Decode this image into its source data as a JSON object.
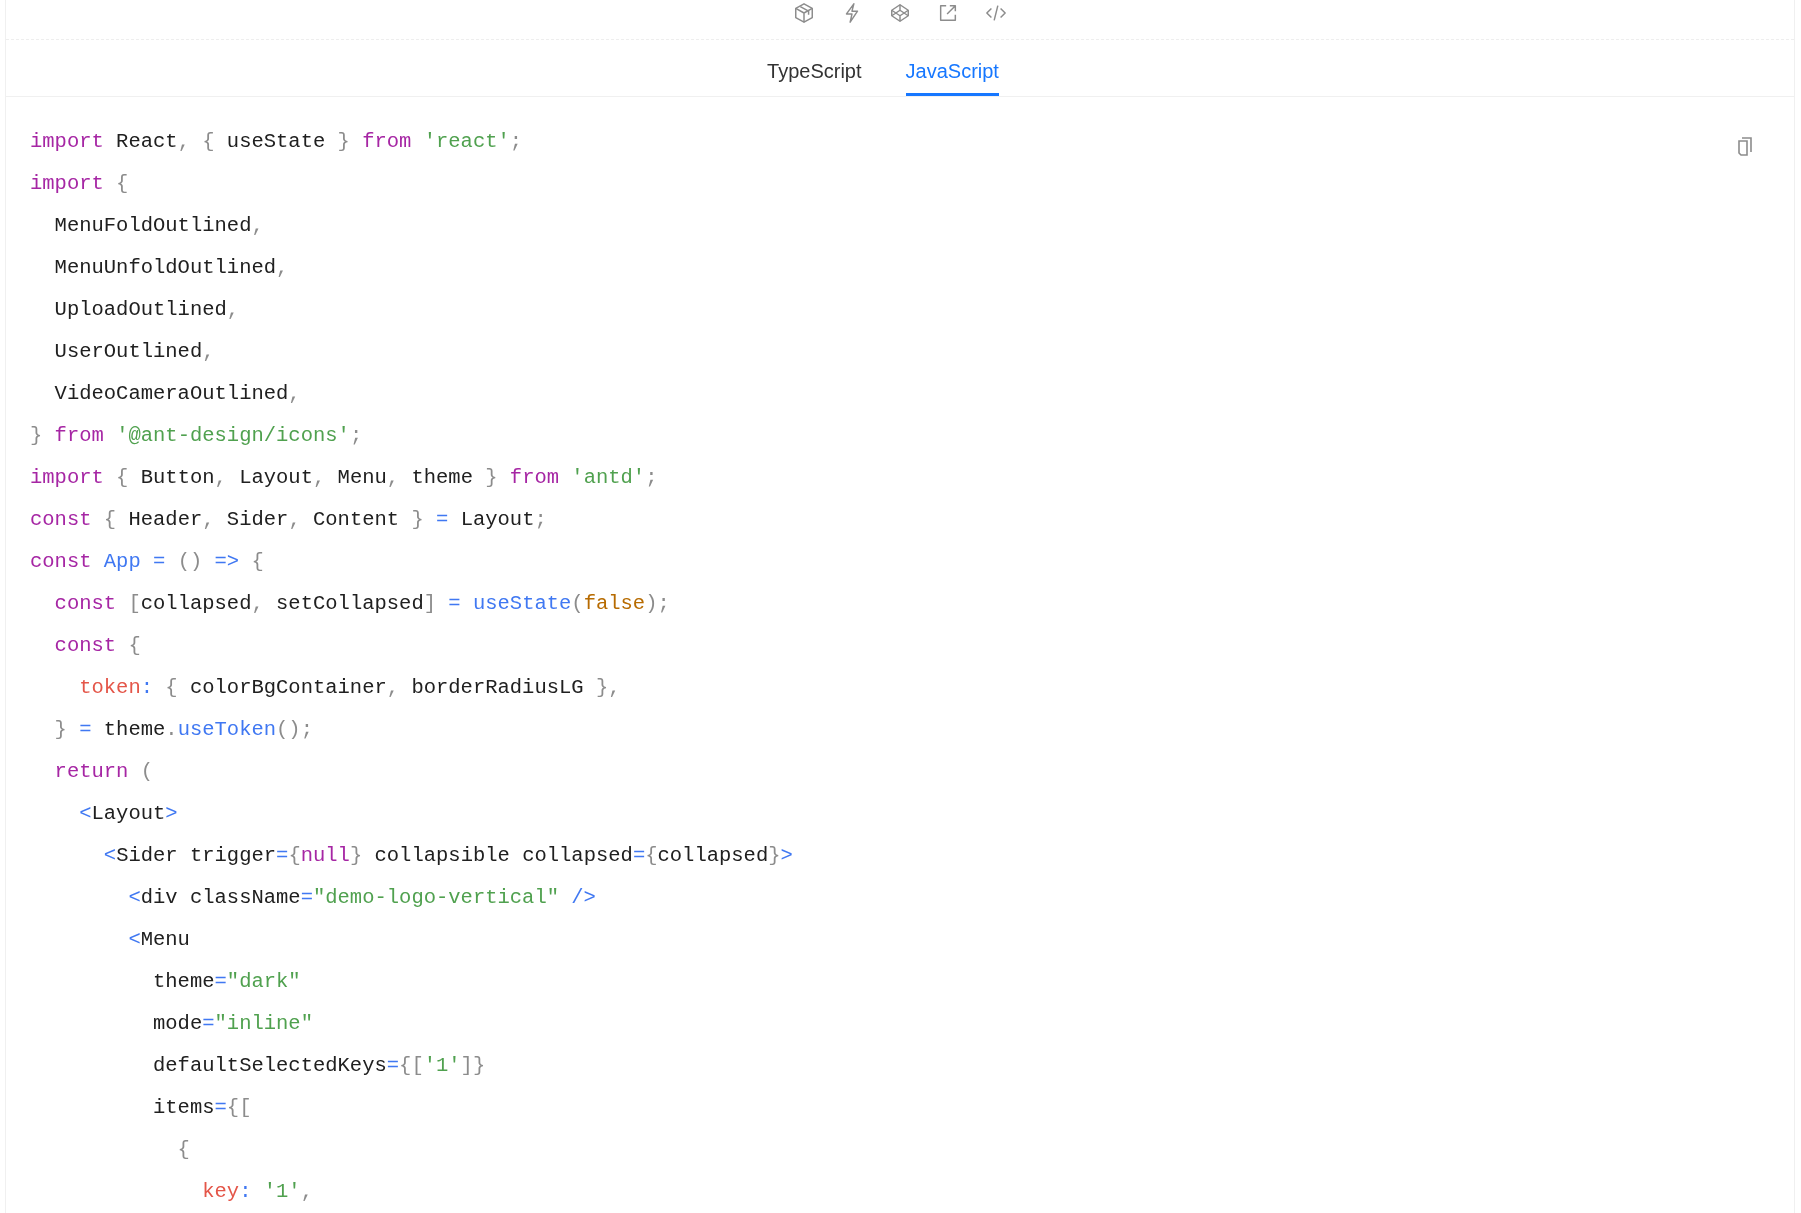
{
  "tabs": [
    {
      "label": "TypeScript",
      "selected": false
    },
    {
      "label": "JavaScript",
      "selected": true
    }
  ],
  "code": {
    "lines": [
      [
        {
          "kind": "keyword",
          "text": "import"
        },
        {
          "kind": "plain",
          "text": " React"
        },
        {
          "kind": "punct",
          "text": ", {"
        },
        {
          "kind": "plain",
          "text": " useState"
        },
        {
          "kind": "punct",
          "text": " }"
        },
        {
          "kind": "keyword",
          "text": " from"
        },
        {
          "kind": "string",
          "text": " 'react'"
        },
        {
          "kind": "punct",
          "text": ";"
        }
      ],
      [
        {
          "kind": "keyword",
          "text": "import"
        },
        {
          "kind": "punct",
          "text": " {"
        }
      ],
      [
        {
          "kind": "plain",
          "text": "  MenuFoldOutlined"
        },
        {
          "kind": "punct",
          "text": ","
        }
      ],
      [
        {
          "kind": "plain",
          "text": "  MenuUnfoldOutlined"
        },
        {
          "kind": "punct",
          "text": ","
        }
      ],
      [
        {
          "kind": "plain",
          "text": "  UploadOutlined"
        },
        {
          "kind": "punct",
          "text": ","
        }
      ],
      [
        {
          "kind": "plain",
          "text": "  UserOutlined"
        },
        {
          "kind": "punct",
          "text": ","
        }
      ],
      [
        {
          "kind": "plain",
          "text": "  VideoCameraOutlined"
        },
        {
          "kind": "punct",
          "text": ","
        }
      ],
      [
        {
          "kind": "punct",
          "text": "}"
        },
        {
          "kind": "keyword",
          "text": " from"
        },
        {
          "kind": "string",
          "text": " '@ant-design/icons'"
        },
        {
          "kind": "punct",
          "text": ";"
        }
      ],
      [
        {
          "kind": "keyword",
          "text": "import"
        },
        {
          "kind": "punct",
          "text": " {"
        },
        {
          "kind": "plain",
          "text": " Button"
        },
        {
          "kind": "punct",
          "text": ","
        },
        {
          "kind": "plain",
          "text": " Layout"
        },
        {
          "kind": "punct",
          "text": ","
        },
        {
          "kind": "plain",
          "text": " Menu"
        },
        {
          "kind": "punct",
          "text": ","
        },
        {
          "kind": "plain",
          "text": " theme"
        },
        {
          "kind": "punct",
          "text": " }"
        },
        {
          "kind": "keyword",
          "text": " from"
        },
        {
          "kind": "string",
          "text": " 'antd'"
        },
        {
          "kind": "punct",
          "text": ";"
        }
      ],
      [
        {
          "kind": "keyword",
          "text": "const"
        },
        {
          "kind": "punct",
          "text": " {"
        },
        {
          "kind": "plain",
          "text": " Header"
        },
        {
          "kind": "punct",
          "text": ","
        },
        {
          "kind": "plain",
          "text": " Sider"
        },
        {
          "kind": "punct",
          "text": ","
        },
        {
          "kind": "plain",
          "text": " Content"
        },
        {
          "kind": "punct",
          "text": " }"
        },
        {
          "kind": "operator",
          "text": " ="
        },
        {
          "kind": "plain",
          "text": " Layout"
        },
        {
          "kind": "punct",
          "text": ";"
        }
      ],
      [
        {
          "kind": "keyword",
          "text": "const"
        },
        {
          "kind": "function",
          "text": " App"
        },
        {
          "kind": "operator",
          "text": " ="
        },
        {
          "kind": "punct",
          "text": " ()"
        },
        {
          "kind": "operator",
          "text": " =>"
        },
        {
          "kind": "punct",
          "text": " {"
        }
      ],
      [
        {
          "kind": "keyword",
          "text": "  const"
        },
        {
          "kind": "punct",
          "text": " ["
        },
        {
          "kind": "plain",
          "text": "collapsed"
        },
        {
          "kind": "punct",
          "text": ","
        },
        {
          "kind": "plain",
          "text": " setCollapsed"
        },
        {
          "kind": "punct",
          "text": "]"
        },
        {
          "kind": "operator",
          "text": " ="
        },
        {
          "kind": "function",
          "text": " useState"
        },
        {
          "kind": "punct",
          "text": "("
        },
        {
          "kind": "boolean",
          "text": "false"
        },
        {
          "kind": "punct",
          "text": ");"
        }
      ],
      [
        {
          "kind": "keyword",
          "text": "  const"
        },
        {
          "kind": "punct",
          "text": " {"
        }
      ],
      [
        {
          "kind": "property",
          "text": "    token"
        },
        {
          "kind": "operator",
          "text": ":"
        },
        {
          "kind": "punct",
          "text": " {"
        },
        {
          "kind": "plain",
          "text": " colorBgContainer"
        },
        {
          "kind": "punct",
          "text": ","
        },
        {
          "kind": "plain",
          "text": " borderRadiusLG"
        },
        {
          "kind": "punct",
          "text": " },"
        }
      ],
      [
        {
          "kind": "punct",
          "text": "  }"
        },
        {
          "kind": "operator",
          "text": " ="
        },
        {
          "kind": "plain",
          "text": " theme"
        },
        {
          "kind": "punct",
          "text": "."
        },
        {
          "kind": "function",
          "text": "useToken"
        },
        {
          "kind": "punct",
          "text": "();"
        }
      ],
      [
        {
          "kind": "keyword",
          "text": "  return"
        },
        {
          "kind": "punct",
          "text": " ("
        }
      ],
      [
        {
          "kind": "operator",
          "text": "    <"
        },
        {
          "kind": "plain",
          "text": "Layout"
        },
        {
          "kind": "operator",
          "text": ">"
        }
      ],
      [
        {
          "kind": "operator",
          "text": "      <"
        },
        {
          "kind": "plain",
          "text": "Sider trigger"
        },
        {
          "kind": "operator",
          "text": "="
        },
        {
          "kind": "punct",
          "text": "{"
        },
        {
          "kind": "keyword",
          "text": "null"
        },
        {
          "kind": "punct",
          "text": "}"
        },
        {
          "kind": "plain",
          "text": " collapsible collapsed"
        },
        {
          "kind": "operator",
          "text": "="
        },
        {
          "kind": "punct",
          "text": "{"
        },
        {
          "kind": "plain",
          "text": "collapsed"
        },
        {
          "kind": "punct",
          "text": "}"
        },
        {
          "kind": "operator",
          "text": ">"
        }
      ],
      [
        {
          "kind": "operator",
          "text": "        <"
        },
        {
          "kind": "plain",
          "text": "div className"
        },
        {
          "kind": "operator",
          "text": "="
        },
        {
          "kind": "string",
          "text": "\"demo-logo-vertical\""
        },
        {
          "kind": "operator",
          "text": " />"
        }
      ],
      [
        {
          "kind": "operator",
          "text": "        <"
        },
        {
          "kind": "plain",
          "text": "Menu"
        }
      ],
      [
        {
          "kind": "plain",
          "text": "          theme"
        },
        {
          "kind": "operator",
          "text": "="
        },
        {
          "kind": "string",
          "text": "\"dark\""
        }
      ],
      [
        {
          "kind": "plain",
          "text": "          mode"
        },
        {
          "kind": "operator",
          "text": "="
        },
        {
          "kind": "string",
          "text": "\"inline\""
        }
      ],
      [
        {
          "kind": "plain",
          "text": "          defaultSelectedKeys"
        },
        {
          "kind": "operator",
          "text": "="
        },
        {
          "kind": "punct",
          "text": "{["
        },
        {
          "kind": "string",
          "text": "'1'"
        },
        {
          "kind": "punct",
          "text": "]}"
        }
      ],
      [
        {
          "kind": "plain",
          "text": "          items"
        },
        {
          "kind": "operator",
          "text": "="
        },
        {
          "kind": "punct",
          "text": "{["
        }
      ],
      [
        {
          "kind": "punct",
          "text": "            {"
        }
      ],
      [
        {
          "kind": "property",
          "text": "              key"
        },
        {
          "kind": "operator",
          "text": ":"
        },
        {
          "kind": "string",
          "text": " '1'"
        },
        {
          "kind": "punct",
          "text": ","
        }
      ]
    ]
  }
}
